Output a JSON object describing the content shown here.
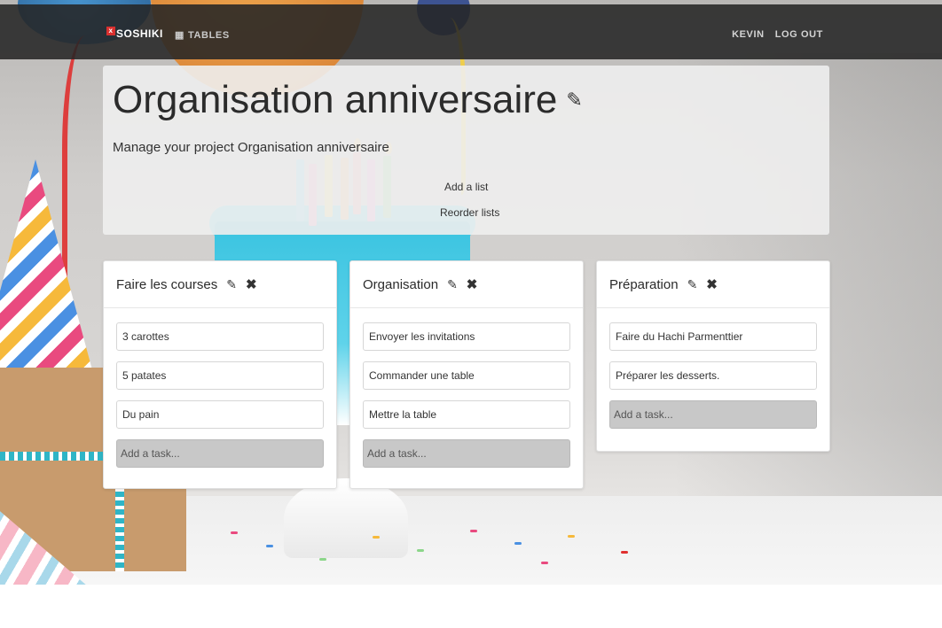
{
  "navbar": {
    "brand": "SOSHIKI",
    "brand_mark": "x",
    "tables_label": "TABLES",
    "tables_icon": "grid-icon",
    "user_label": "KEVIN",
    "logout_label": "LOG OUT"
  },
  "project": {
    "title": "Organisation anniversaire",
    "subtitle": "Manage your project Organisation anniversaire",
    "add_list_label": "Add a list",
    "reorder_lists_label": "Reorder lists"
  },
  "lists": [
    {
      "title": "Faire les courses",
      "tasks": [
        "3 carottes",
        "5 patates",
        "Du pain"
      ],
      "add_task_placeholder": "Add a task..."
    },
    {
      "title": "Organisation",
      "tasks": [
        "Envoyer les invitations",
        "Commander une table",
        "Mettre la table"
      ],
      "add_task_placeholder": "Add a task..."
    },
    {
      "title": "Préparation",
      "tasks": [
        "Faire du Hachi Parmenttier",
        "Préparer les desserts."
      ],
      "add_task_placeholder": "Add a task..."
    }
  ],
  "icons": {
    "edit": "pencil-square-icon",
    "delete": "close-icon"
  },
  "colors": {
    "navbar_bg": "#262626",
    "brand_accent": "#d9302f",
    "add_task_bg": "#c8c8c8"
  }
}
